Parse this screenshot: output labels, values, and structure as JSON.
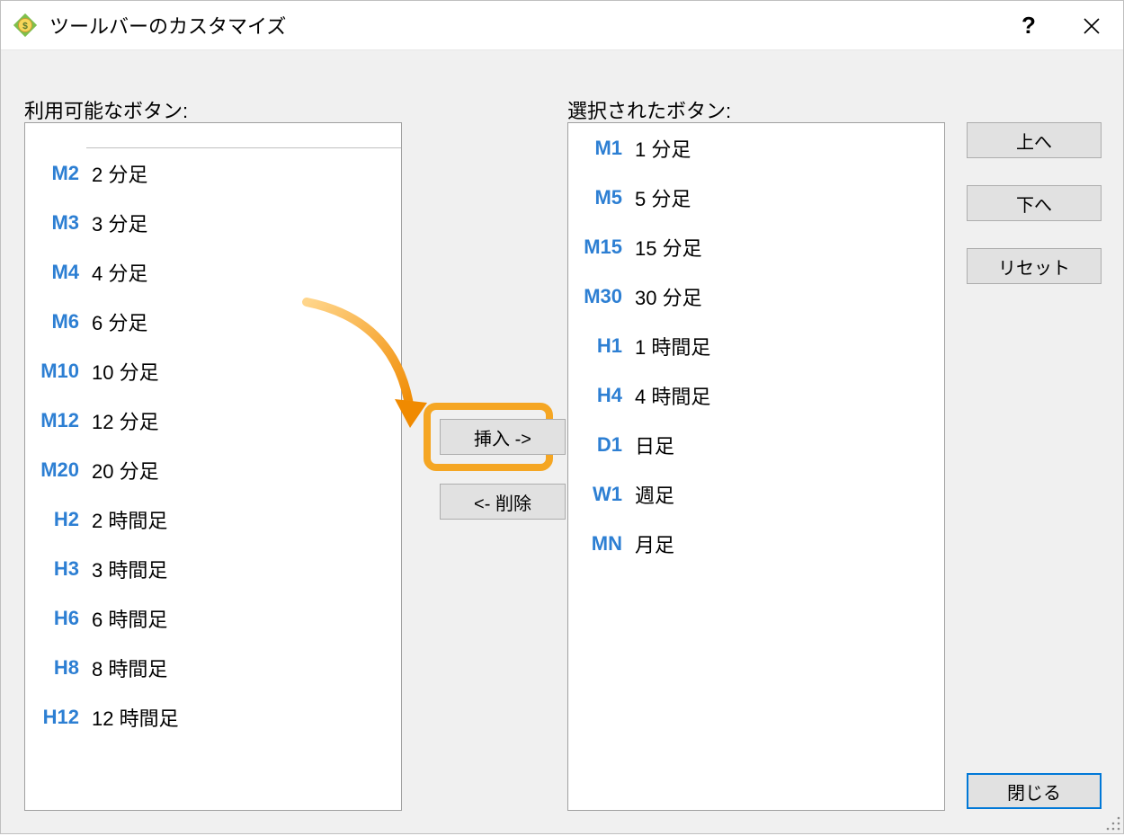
{
  "title": "ツールバーのカスタマイズ",
  "labels": {
    "available": "利用可能なボタン:",
    "selected": "選択されたボタン:"
  },
  "available_items": [
    {
      "code": "M2",
      "label": "2 分足"
    },
    {
      "code": "M3",
      "label": "3 分足"
    },
    {
      "code": "M4",
      "label": "4 分足"
    },
    {
      "code": "M6",
      "label": "6 分足"
    },
    {
      "code": "M10",
      "label": "10 分足"
    },
    {
      "code": "M12",
      "label": "12 分足"
    },
    {
      "code": "M20",
      "label": "20 分足"
    },
    {
      "code": "H2",
      "label": "2 時間足"
    },
    {
      "code": "H3",
      "label": "3 時間足"
    },
    {
      "code": "H6",
      "label": "6 時間足"
    },
    {
      "code": "H8",
      "label": "8 時間足"
    },
    {
      "code": "H12",
      "label": "12 時間足"
    }
  ],
  "selected_items": [
    {
      "code": "M1",
      "label": "1 分足"
    },
    {
      "code": "M5",
      "label": "5 分足"
    },
    {
      "code": "M15",
      "label": "15 分足"
    },
    {
      "code": "M30",
      "label": "30 分足"
    },
    {
      "code": "H1",
      "label": "1 時間足"
    },
    {
      "code": "H4",
      "label": "4 時間足"
    },
    {
      "code": "D1",
      "label": "日足"
    },
    {
      "code": "W1",
      "label": "週足"
    },
    {
      "code": "MN",
      "label": "月足"
    }
  ],
  "buttons": {
    "insert": "挿入 ->",
    "remove": "<- 削除",
    "up": "上へ",
    "down": "下へ",
    "reset": "リセット",
    "close": "閉じる"
  }
}
